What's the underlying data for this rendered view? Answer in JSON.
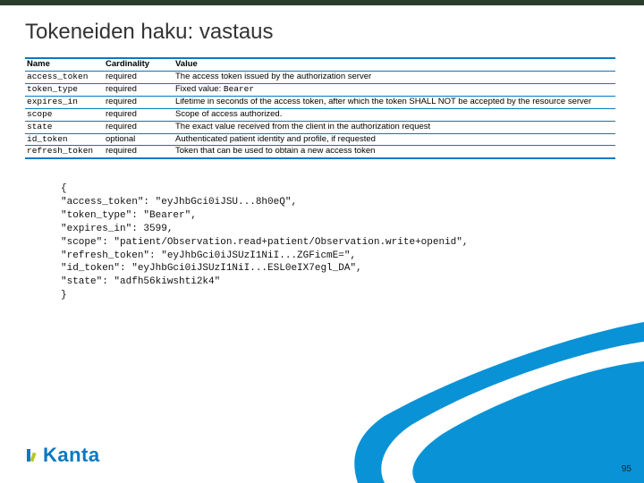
{
  "title": "Tokeneiden haku: vastaus",
  "table": {
    "headers": [
      "Name",
      "Cardinality",
      "Value"
    ],
    "rows": [
      {
        "name": "access_token",
        "card": "required",
        "value": "The access token issued by the authorization server"
      },
      {
        "name": "token_type",
        "card": "required",
        "value": "Fixed value: Bearer",
        "value_mono_suffix": "Bearer",
        "value_prefix": "Fixed value: "
      },
      {
        "name": "expires_in",
        "card": "required",
        "value": "Lifetime in seconds of the access token, after which the token SHALL NOT be accepted by the resource server"
      },
      {
        "name": "scope",
        "card": "required",
        "value": "Scope of access authorized."
      },
      {
        "name": "state",
        "card": "required",
        "value": "The exact value received from the client in the authorization request"
      },
      {
        "name": "id_token",
        "card": "optional",
        "value": "Authenticated patient identity and profile, if requested"
      },
      {
        "name": "refresh_token",
        "card": "required",
        "value": "Token that can be used to obtain a new access token"
      }
    ]
  },
  "code_lines": [
    "{",
    "\"access_token\": \"eyJhbGci0iJSU...8h0eQ\",",
    "\"token_type\": \"Bearer\",",
    "\"expires_in\": 3599,",
    "\"scope\": \"patient/Observation.read+patient/Observation.write+openid\",",
    "\"refresh_token\": \"eyJhbGci0iJSUzI1NiI...ZGFicmE=\",",
    "\"id_token\": \"eyJhbGci0iJSUzI1NiI...ESL0eIX7egl_DA\",",
    "\"state\": \"adfh56kiwshti2k4\"",
    "}"
  ],
  "logo_text": "Kanta",
  "page_number": "95"
}
